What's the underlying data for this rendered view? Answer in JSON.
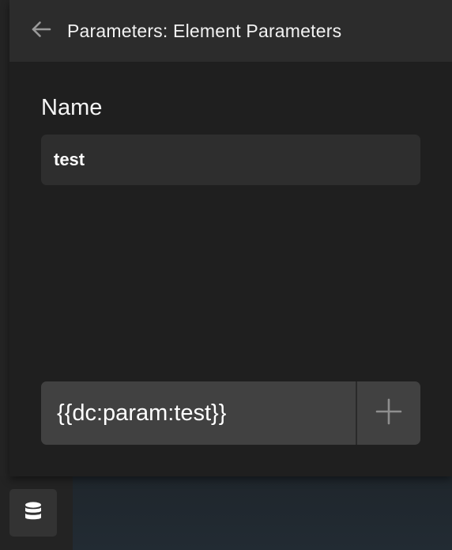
{
  "header": {
    "back_icon": "arrow-left-icon",
    "title": "Parameters: Element Parameters"
  },
  "form": {
    "name_label": "Name",
    "name_value": "test"
  },
  "dynamic_tag": {
    "value": "{{dc:param:test}}",
    "add_icon": "plus-icon"
  },
  "footer": {
    "database_icon": "database-icon"
  },
  "colors": {
    "panel_bg": "#1f1f1f",
    "header_bg": "#2c2c2c",
    "input_bg": "#2e2e2e",
    "tag_bg": "#414141",
    "text": "#f2f2f2"
  }
}
